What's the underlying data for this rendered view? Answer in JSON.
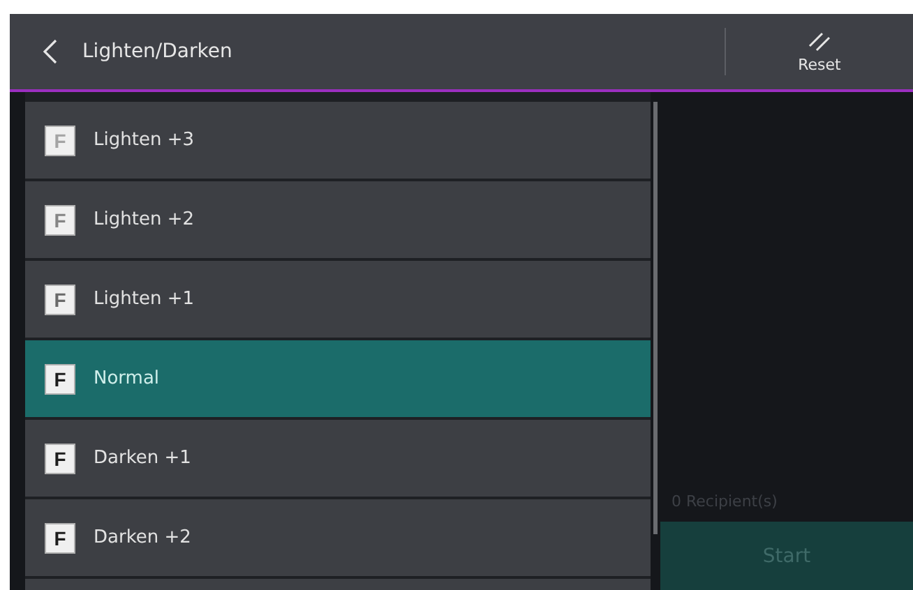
{
  "header": {
    "title": "Lighten/Darken",
    "reset_label": "Reset"
  },
  "options": [
    {
      "glyph": "F",
      "label": "Lighten +3",
      "color": "#a4a4a4",
      "selected": false
    },
    {
      "glyph": "F",
      "label": "Lighten +2",
      "color": "#858585",
      "selected": false
    },
    {
      "glyph": "F",
      "label": "Lighten +1",
      "color": "#6a6a6a",
      "selected": false
    },
    {
      "glyph": "F",
      "label": "Normal",
      "color": "#1e1e1e",
      "selected": true
    },
    {
      "glyph": "F",
      "label": "Darken +1",
      "color": "#1e1e1e",
      "selected": false
    },
    {
      "glyph": "F",
      "label": "Darken +2",
      "color": "#1e1e1e",
      "selected": false
    }
  ],
  "side": {
    "recipients": "0 Recipient(s)",
    "start": {
      "label": "Start",
      "disabled": true
    }
  }
}
